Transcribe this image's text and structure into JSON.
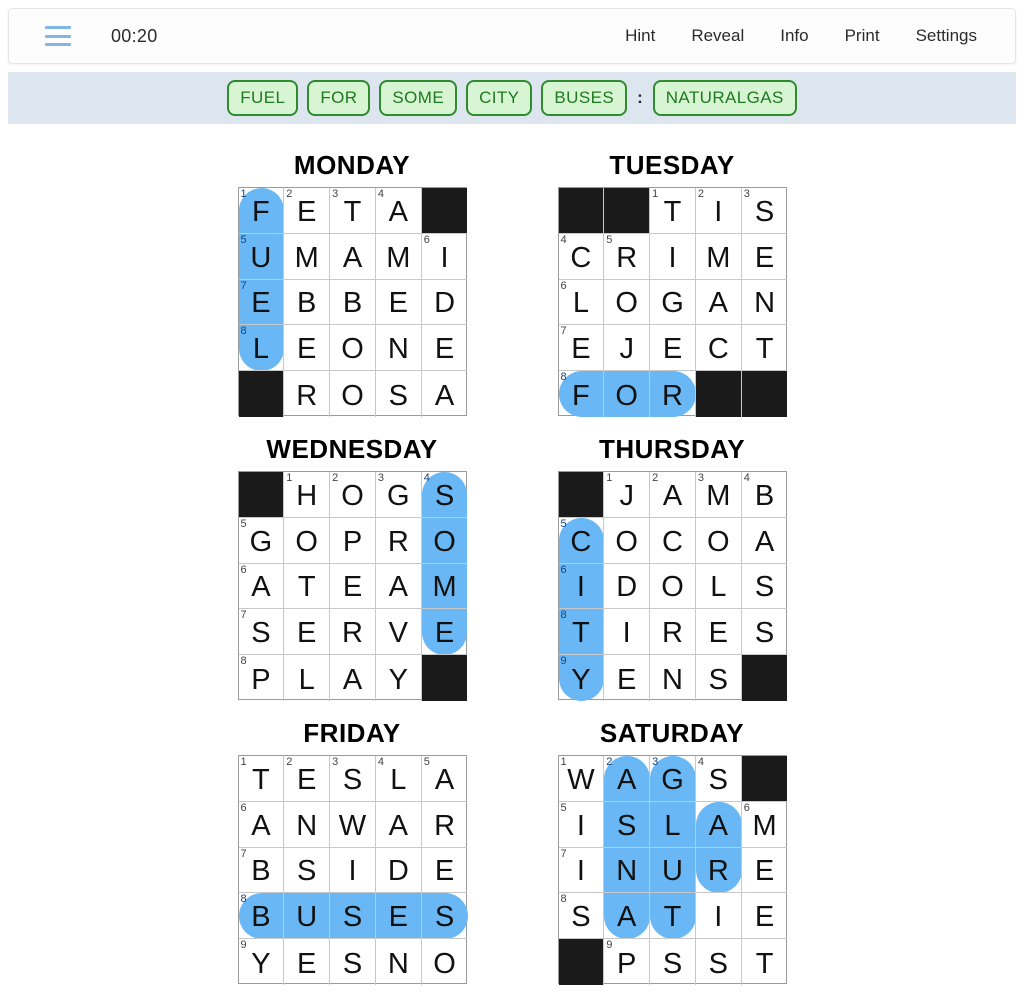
{
  "toolbar": {
    "menu_icon": "hamburger-menu-icon",
    "timer": "00:20",
    "nav": [
      {
        "label": "Hint"
      },
      {
        "label": "Reveal"
      },
      {
        "label": "Info"
      },
      {
        "label": "Print"
      },
      {
        "label": "Settings"
      }
    ]
  },
  "answer_bar": {
    "chips": [
      "FUEL",
      "FOR",
      "SOME",
      "CITY",
      "BUSES"
    ],
    "separator": ":",
    "solution_chip": "NATURALGAS"
  },
  "colors": {
    "highlight": "#69b8f5",
    "chip_border": "#2e8b2e",
    "chip_background": "#d8f5d3",
    "chip_text": "#1e7a1e",
    "chipbar_background": "#dde5ef",
    "black_cell": "#1a1a1a",
    "menu_icon": "#7fb5e8"
  },
  "boards": [
    {
      "title": "MONDAY",
      "rows": 5,
      "cols": 5,
      "cells": [
        [
          {
            "l": "F",
            "n": "1",
            "h": true
          },
          {
            "l": "E",
            "n": "2"
          },
          {
            "l": "T",
            "n": "3"
          },
          {
            "l": "A",
            "n": "4"
          },
          {
            "black": true
          }
        ],
        [
          {
            "l": "U",
            "n": "5",
            "h": true
          },
          {
            "l": "M"
          },
          {
            "l": "A"
          },
          {
            "l": "M"
          },
          {
            "l": "I",
            "n": "6"
          }
        ],
        [
          {
            "l": "E",
            "n": "7",
            "h": true
          },
          {
            "l": "B"
          },
          {
            "l": "B"
          },
          {
            "l": "E"
          },
          {
            "l": "D"
          }
        ],
        [
          {
            "l": "L",
            "n": "8",
            "h": true
          },
          {
            "l": "E"
          },
          {
            "l": "O"
          },
          {
            "l": "N"
          },
          {
            "l": "E"
          }
        ],
        [
          {
            "black": true
          },
          {
            "l": "R"
          },
          {
            "l": "O"
          },
          {
            "l": "S"
          },
          {
            "l": "A"
          }
        ]
      ],
      "pills": [
        {
          "r": 0,
          "c": 0,
          "len": 4,
          "dir": "v"
        }
      ]
    },
    {
      "title": "TUESDAY",
      "rows": 5,
      "cols": 5,
      "cells": [
        [
          {
            "black": true
          },
          {
            "black": true
          },
          {
            "l": "T",
            "n": "1"
          },
          {
            "l": "I",
            "n": "2"
          },
          {
            "l": "S",
            "n": "3"
          }
        ],
        [
          {
            "l": "C",
            "n": "4"
          },
          {
            "l": "R",
            "n": "5"
          },
          {
            "l": "I"
          },
          {
            "l": "M"
          },
          {
            "l": "E"
          }
        ],
        [
          {
            "l": "L",
            "n": "6"
          },
          {
            "l": "O"
          },
          {
            "l": "G"
          },
          {
            "l": "A"
          },
          {
            "l": "N"
          }
        ],
        [
          {
            "l": "E",
            "n": "7"
          },
          {
            "l": "J"
          },
          {
            "l": "E"
          },
          {
            "l": "C"
          },
          {
            "l": "T"
          }
        ],
        [
          {
            "l": "F",
            "n": "8",
            "h": true
          },
          {
            "l": "O",
            "h": true
          },
          {
            "l": "R",
            "h": true
          },
          {
            "black": true
          },
          {
            "black": true
          }
        ]
      ],
      "pills": [
        {
          "r": 4,
          "c": 0,
          "len": 3,
          "dir": "h"
        }
      ]
    },
    {
      "title": "WEDNESDAY",
      "rows": 5,
      "cols": 5,
      "cells": [
        [
          {
            "black": true
          },
          {
            "l": "H",
            "n": "1"
          },
          {
            "l": "O",
            "n": "2"
          },
          {
            "l": "G",
            "n": "3"
          },
          {
            "l": "S",
            "n": "4",
            "h": true
          }
        ],
        [
          {
            "l": "G",
            "n": "5"
          },
          {
            "l": "O"
          },
          {
            "l": "P"
          },
          {
            "l": "R"
          },
          {
            "l": "O",
            "h": true
          }
        ],
        [
          {
            "l": "A",
            "n": "6"
          },
          {
            "l": "T"
          },
          {
            "l": "E"
          },
          {
            "l": "A"
          },
          {
            "l": "M",
            "h": true
          }
        ],
        [
          {
            "l": "S",
            "n": "7"
          },
          {
            "l": "E"
          },
          {
            "l": "R"
          },
          {
            "l": "V"
          },
          {
            "l": "E",
            "h": true
          }
        ],
        [
          {
            "l": "P",
            "n": "8"
          },
          {
            "l": "L"
          },
          {
            "l": "A"
          },
          {
            "l": "Y"
          },
          {
            "black": true
          }
        ]
      ],
      "pills": [
        {
          "r": 0,
          "c": 4,
          "len": 4,
          "dir": "v"
        }
      ]
    },
    {
      "title": "THURSDAY",
      "rows": 5,
      "cols": 5,
      "cells": [
        [
          {
            "black": true
          },
          {
            "l": "J",
            "n": "1"
          },
          {
            "l": "A",
            "n": "2"
          },
          {
            "l": "M",
            "n": "3"
          },
          {
            "l": "B",
            "n": "4"
          }
        ],
        [
          {
            "l": "C",
            "n": "5",
            "h": true
          },
          {
            "l": "O"
          },
          {
            "l": "C"
          },
          {
            "l": "O"
          },
          {
            "l": "A"
          }
        ],
        [
          {
            "l": "I",
            "n": "6",
            "h": true
          },
          {
            "l": "D"
          },
          {
            "l": "O"
          },
          {
            "l": "L"
          },
          {
            "l": "S"
          }
        ],
        [
          {
            "l": "T",
            "n": "8",
            "h": true
          },
          {
            "l": "I"
          },
          {
            "l": "R"
          },
          {
            "l": "E"
          },
          {
            "l": "S"
          }
        ],
        [
          {
            "l": "Y",
            "n": "9",
            "h": true
          },
          {
            "l": "E"
          },
          {
            "l": "N"
          },
          {
            "l": "S"
          },
          {
            "black": true
          }
        ]
      ],
      "pills": [
        {
          "r": 1,
          "c": 0,
          "len": 4,
          "dir": "v"
        }
      ]
    },
    {
      "title": "FRIDAY",
      "rows": 5,
      "cols": 5,
      "cells": [
        [
          {
            "l": "T",
            "n": "1"
          },
          {
            "l": "E",
            "n": "2"
          },
          {
            "l": "S",
            "n": "3"
          },
          {
            "l": "L",
            "n": "4"
          },
          {
            "l": "A",
            "n": "5"
          }
        ],
        [
          {
            "l": "A",
            "n": "6"
          },
          {
            "l": "N"
          },
          {
            "l": "W"
          },
          {
            "l": "A"
          },
          {
            "l": "R"
          }
        ],
        [
          {
            "l": "B",
            "n": "7"
          },
          {
            "l": "S"
          },
          {
            "l": "I"
          },
          {
            "l": "D"
          },
          {
            "l": "E"
          }
        ],
        [
          {
            "l": "B",
            "n": "8",
            "h": true
          },
          {
            "l": "U",
            "h": true
          },
          {
            "l": "S",
            "h": true
          },
          {
            "l": "E",
            "h": true
          },
          {
            "l": "S",
            "h": true
          }
        ],
        [
          {
            "l": "Y",
            "n": "9"
          },
          {
            "l": "E"
          },
          {
            "l": "S"
          },
          {
            "l": "N"
          },
          {
            "l": "O"
          }
        ]
      ],
      "pills": [
        {
          "r": 3,
          "c": 0,
          "len": 5,
          "dir": "h"
        }
      ]
    },
    {
      "title": "SATURDAY",
      "rows": 5,
      "cols": 5,
      "cells": [
        [
          {
            "l": "W",
            "n": "1"
          },
          {
            "l": "A",
            "n": "2",
            "h": true
          },
          {
            "l": "G",
            "n": "3",
            "h": true
          },
          {
            "l": "S",
            "n": "4"
          },
          {
            "black": true
          }
        ],
        [
          {
            "l": "I",
            "n": "5"
          },
          {
            "l": "S",
            "h": true
          },
          {
            "l": "L",
            "h": true
          },
          {
            "l": "A",
            "h": true
          },
          {
            "l": "M",
            "n": "6"
          }
        ],
        [
          {
            "l": "I",
            "n": "7"
          },
          {
            "l": "N",
            "h": true
          },
          {
            "l": "U",
            "h": true
          },
          {
            "l": "R",
            "h": true
          },
          {
            "l": "E"
          }
        ],
        [
          {
            "l": "S",
            "n": "8"
          },
          {
            "l": "A",
            "h": true
          },
          {
            "l": "T",
            "h": true
          },
          {
            "l": "I"
          },
          {
            "l": "E"
          }
        ],
        [
          {
            "black": true
          },
          {
            "l": "P",
            "n": "9"
          },
          {
            "l": "S"
          },
          {
            "l": "S"
          },
          {
            "l": "T"
          }
        ]
      ],
      "pills": [
        {
          "r": 0,
          "c": 1,
          "len": 4,
          "dir": "v"
        },
        {
          "r": 0,
          "c": 2,
          "len": 4,
          "dir": "v"
        },
        {
          "r": 1,
          "c": 3,
          "len": 2,
          "dir": "v"
        }
      ]
    }
  ]
}
